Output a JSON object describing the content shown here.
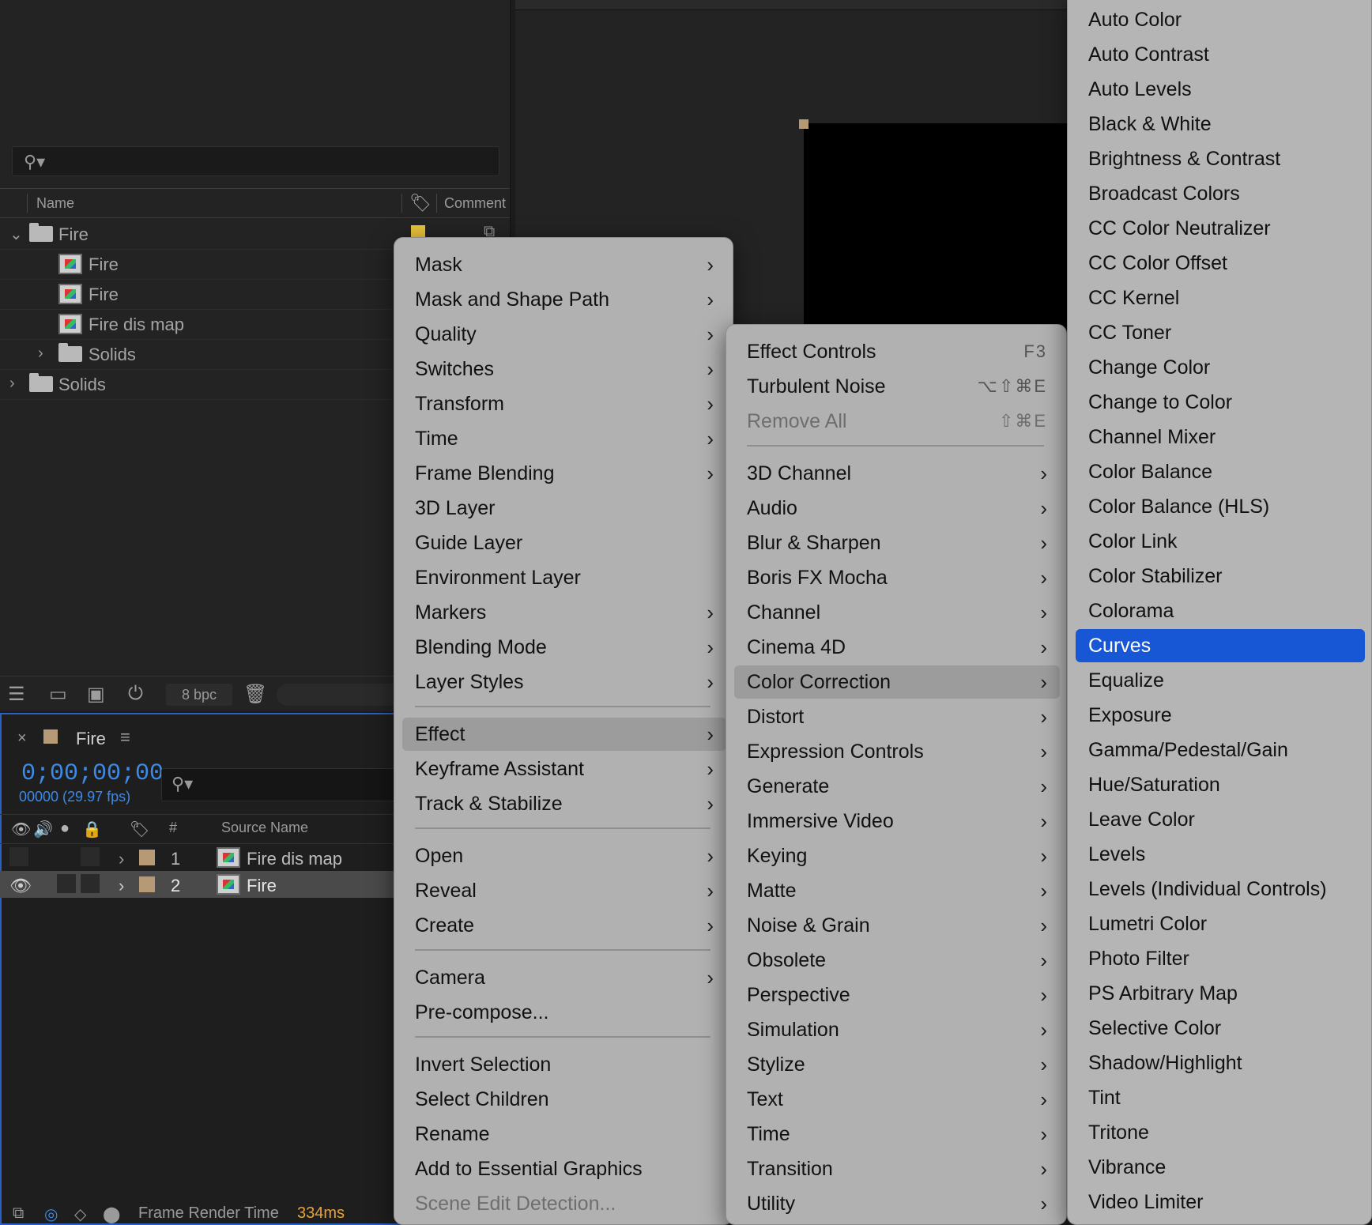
{
  "project": {
    "header": {
      "name": "Name",
      "comment": "Comment"
    },
    "rows": [
      {
        "label": "Fire"
      },
      {
        "label": "Fire"
      },
      {
        "label": "Fire"
      },
      {
        "label": "Fire dis map"
      },
      {
        "label": "Solids"
      },
      {
        "label": "Solids"
      }
    ],
    "bpc": "8 bpc"
  },
  "timeline": {
    "tab_name": "Fire",
    "timecode": "0;00;00;00",
    "fps": "00000 (29.97 fps)",
    "header": {
      "num": "#",
      "source": "Source Name"
    },
    "layers": [
      {
        "num": "1",
        "name": "Fire dis map"
      },
      {
        "num": "2",
        "name": "Fire"
      }
    ],
    "render_label": "Frame Render Time",
    "render_value": "334ms"
  },
  "menu1": {
    "items": [
      "Mask",
      "Mask and Shape Path",
      "Quality",
      "Switches",
      "Transform",
      "Time",
      "Frame Blending",
      "3D Layer",
      "Guide Layer",
      "Environment Layer",
      "Markers",
      "Blending Mode",
      "Layer Styles",
      "Effect",
      "Keyframe Assistant",
      "Track & Stabilize",
      "Open",
      "Reveal",
      "Create",
      "Camera",
      "Pre-compose...",
      "Invert Selection",
      "Select Children",
      "Rename",
      "Add to Essential Graphics",
      "Scene Edit Detection..."
    ]
  },
  "menu2": {
    "top_items": [
      {
        "label": "Effect Controls",
        "shortcut": "F3"
      },
      {
        "label": "Turbulent Noise",
        "shortcut": "⌥⇧⌘E"
      },
      {
        "label": "Remove All",
        "shortcut": "⇧⌘E"
      }
    ],
    "categories": [
      "3D Channel",
      "Audio",
      "Blur & Sharpen",
      "Boris FX Mocha",
      "Channel",
      "Cinema 4D",
      "Color Correction",
      "Distort",
      "Expression Controls",
      "Generate",
      "Immersive Video",
      "Keying",
      "Matte",
      "Noise & Grain",
      "Obsolete",
      "Perspective",
      "Simulation",
      "Stylize",
      "Text",
      "Time",
      "Transition",
      "Utility"
    ]
  },
  "menu3": {
    "items": [
      "Auto Color",
      "Auto Contrast",
      "Auto Levels",
      "Black & White",
      "Brightness & Contrast",
      "Broadcast Colors",
      "CC Color Neutralizer",
      "CC Color Offset",
      "CC Kernel",
      "CC Toner",
      "Change Color",
      "Change to Color",
      "Channel Mixer",
      "Color Balance",
      "Color Balance (HLS)",
      "Color Link",
      "Color Stabilizer",
      "Colorama",
      "Curves",
      "Equalize",
      "Exposure",
      "Gamma/Pedestal/Gain",
      "Hue/Saturation",
      "Leave Color",
      "Levels",
      "Levels (Individual Controls)",
      "Lumetri Color",
      "Photo Filter",
      "PS Arbitrary Map",
      "Selective Color",
      "Shadow/Highlight",
      "Tint",
      "Tritone",
      "Vibrance",
      "Video Limiter"
    ]
  },
  "colors": {
    "accent": "#1757d6",
    "timecode": "#3d8ae8",
    "render_value": "#e8a33a",
    "label_tan": "#b69a76",
    "label_yellow": "#e8c23a"
  }
}
